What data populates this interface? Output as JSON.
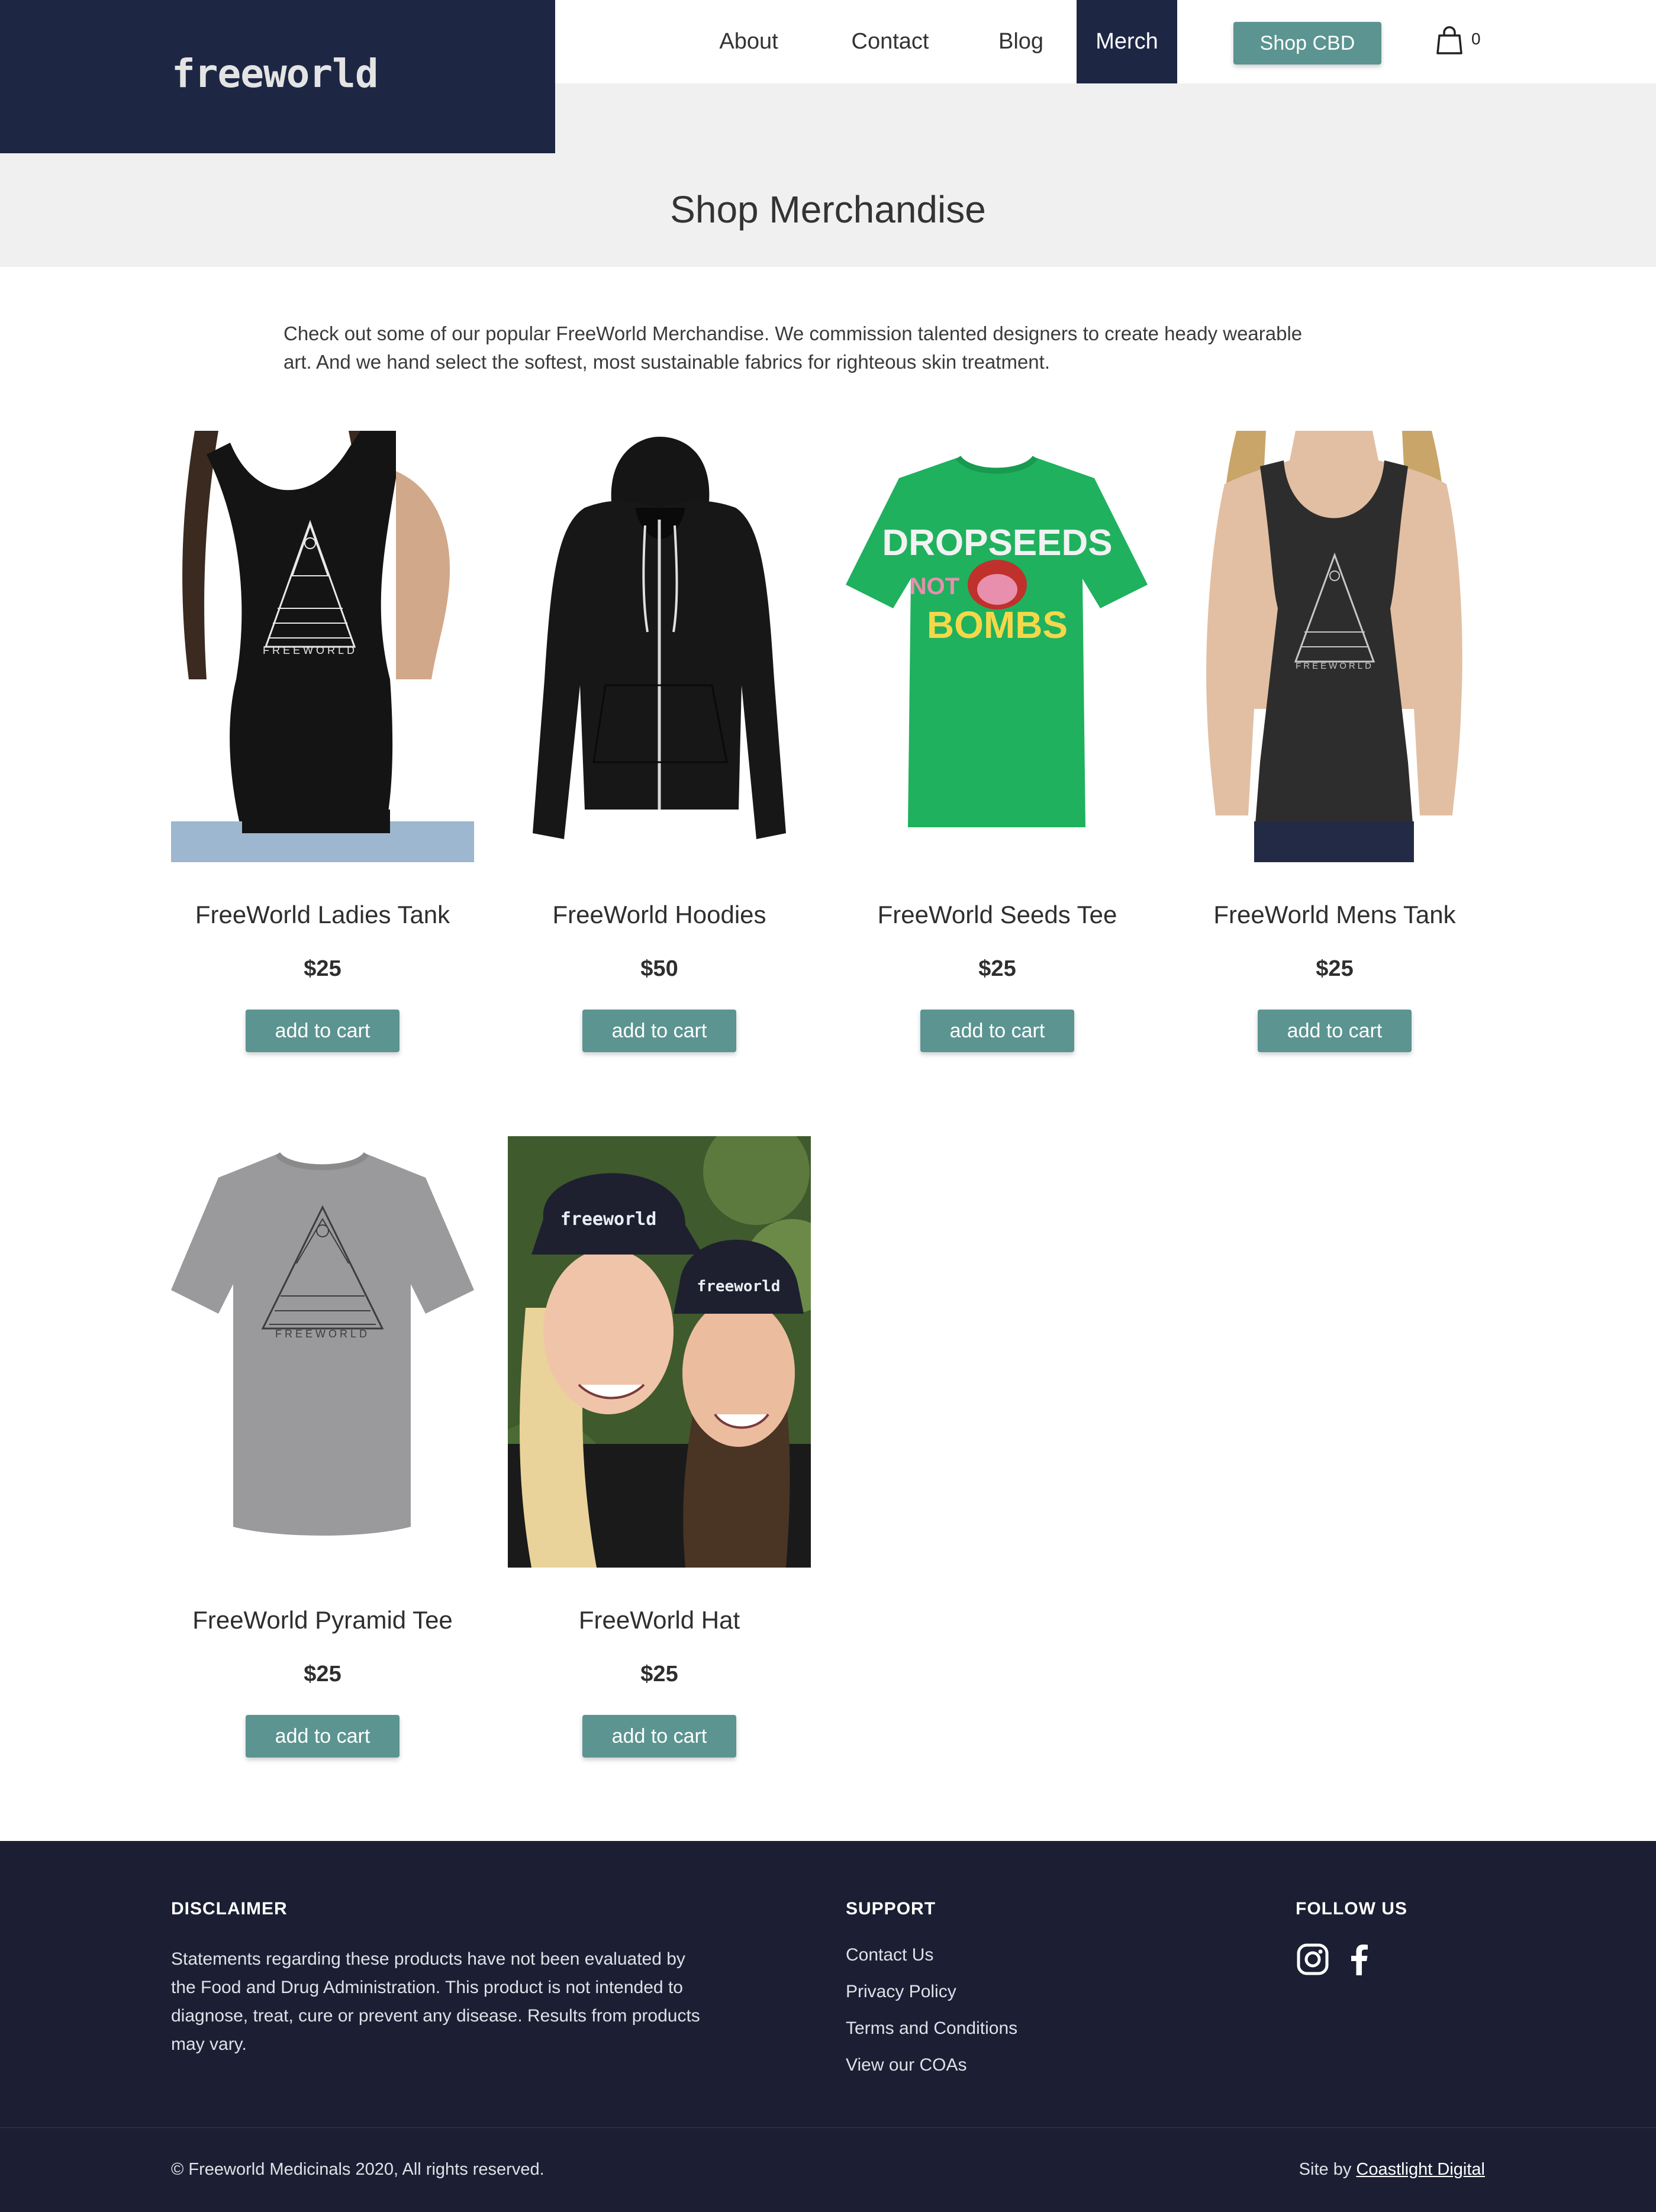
{
  "header": {
    "logo_text": "freeworld",
    "nav": [
      "About",
      "Contact",
      "Blog",
      "Merch"
    ],
    "active_nav": "Merch",
    "cta_label": "Shop CBD",
    "cart_count": "0"
  },
  "page": {
    "title": "Shop Merchandise",
    "intro": "Check out some of our popular FreeWorld Merchandise. We commission talented designers to create heady wearable art. And we hand select the softest, most sustainable fabrics for righteous skin treatment."
  },
  "products": [
    {
      "name": "FreeWorld Ladies Tank",
      "price": "$25",
      "button": "add to cart"
    },
    {
      "name": "FreeWorld Hoodies",
      "price": "$50",
      "button": "add to cart"
    },
    {
      "name": "FreeWorld Seeds Tee",
      "price": "$25",
      "button": "add to cart",
      "print_lines": [
        "DROPSEEDS",
        "NOT",
        "BOMBS"
      ]
    },
    {
      "name": "FreeWorld Mens Tank",
      "price": "$25",
      "button": "add to cart"
    },
    {
      "name": "FreeWorld Pyramid Tee",
      "price": "$25",
      "button": "add to cart"
    },
    {
      "name": "FreeWorld Hat",
      "price": "$25",
      "button": "add to cart"
    }
  ],
  "garment_print": "FREEWORLD",
  "hat_print": "freeworld",
  "footer": {
    "disclaimer_heading": "DISCLAIMER",
    "disclaimer_text": "Statements regarding these products have not been evaluated by the Food and Drug Administration. This product is not intended to diagnose, treat, cure or prevent any disease. Results from products may vary.",
    "support_heading": "SUPPORT",
    "support_links": [
      "Contact Us",
      "Privacy Policy",
      "Terms and Conditions",
      "View our COAs"
    ],
    "follow_heading": "FOLLOW US",
    "social_icons": [
      "instagram-icon",
      "facebook-icon"
    ],
    "copyright": "© Freeworld Medicinals 2020, All rights reserved.",
    "site_by_prefix": "Site by ",
    "site_by_link": "Coastlight Digital"
  },
  "colors": {
    "navy": "#1d2744",
    "teal": "#5b9490",
    "banner_gray": "#f0f0f0",
    "footer_bg": "#1c1f33"
  }
}
